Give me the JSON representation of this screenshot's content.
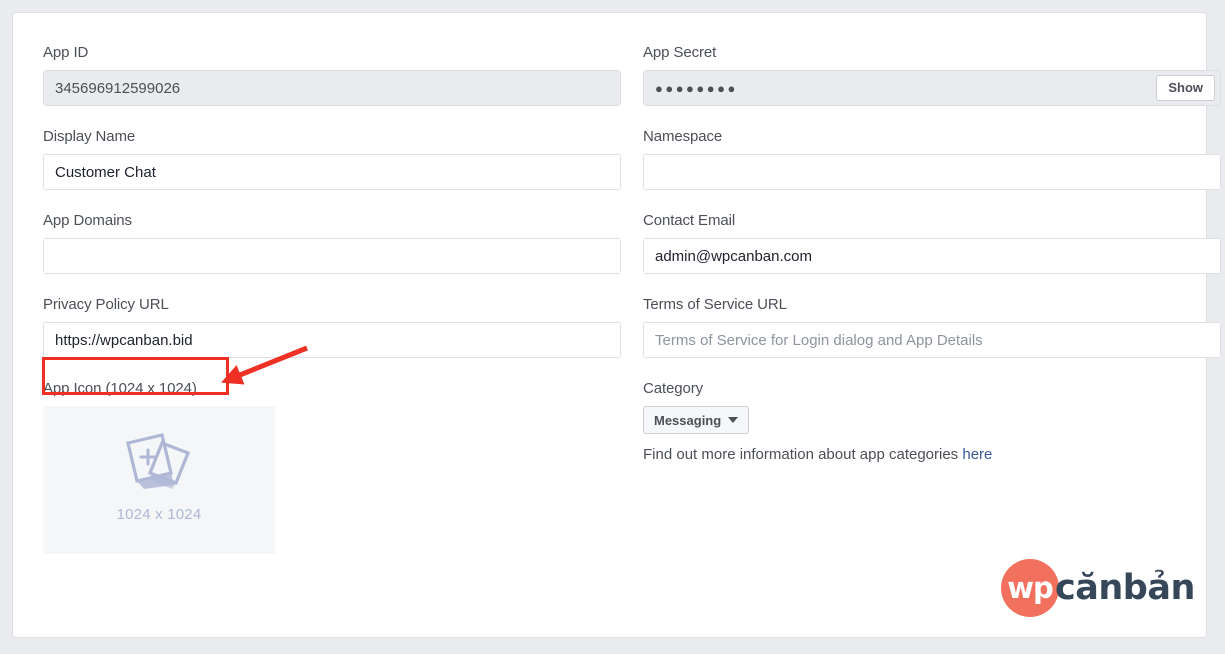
{
  "form": {
    "app_id": {
      "label": "App ID",
      "value": "345696912599026",
      "placeholder": ""
    },
    "app_secret": {
      "label": "App Secret",
      "masked_value": "●●●●●●●●",
      "show_button_label": "Show"
    },
    "display_name": {
      "label": "Display Name",
      "value": "Customer Chat",
      "placeholder": ""
    },
    "namespace": {
      "label": "Namespace",
      "value": "",
      "placeholder": ""
    },
    "app_domains": {
      "label": "App Domains",
      "value": "",
      "placeholder": ""
    },
    "contact_email": {
      "label": "Contact Email",
      "value": "admin@wpcanban.com",
      "placeholder": ""
    },
    "privacy_policy_url": {
      "label": "Privacy Policy URL",
      "value": "https://wpcanban.bid",
      "placeholder": ""
    },
    "terms_of_service_url": {
      "label": "Terms of Service URL",
      "value": "",
      "placeholder": "Terms of Service for Login dialog and App Details"
    },
    "app_icon": {
      "label": "App Icon (1024 x 1024)",
      "size_text": "1024 x 1024",
      "icon": "add-photo-icon"
    },
    "category": {
      "label": "Category",
      "selected": "Messaging",
      "caret_icon": "chevron-down-icon",
      "help_text": "Find out more information about app categories",
      "help_link_label": "here"
    }
  },
  "annotation": {
    "highlight_icon": "red-rectangle-highlight",
    "arrow_icon": "red-arrow-icon",
    "color": "#ee3124"
  },
  "logo": {
    "mark_text": "wp",
    "word_text": "cănbản",
    "mark_color": "#f1715e",
    "word_color": "#37475a"
  },
  "colors": {
    "page_background": "#e9ebee",
    "card_background": "#ffffff",
    "label": "#4b4f56",
    "input_border": "#dddfe2",
    "disabled_input": "#e9ebee",
    "link": "#385898",
    "placeholder": "#8d949e",
    "icon_placeholder": "#aeb7d6"
  }
}
